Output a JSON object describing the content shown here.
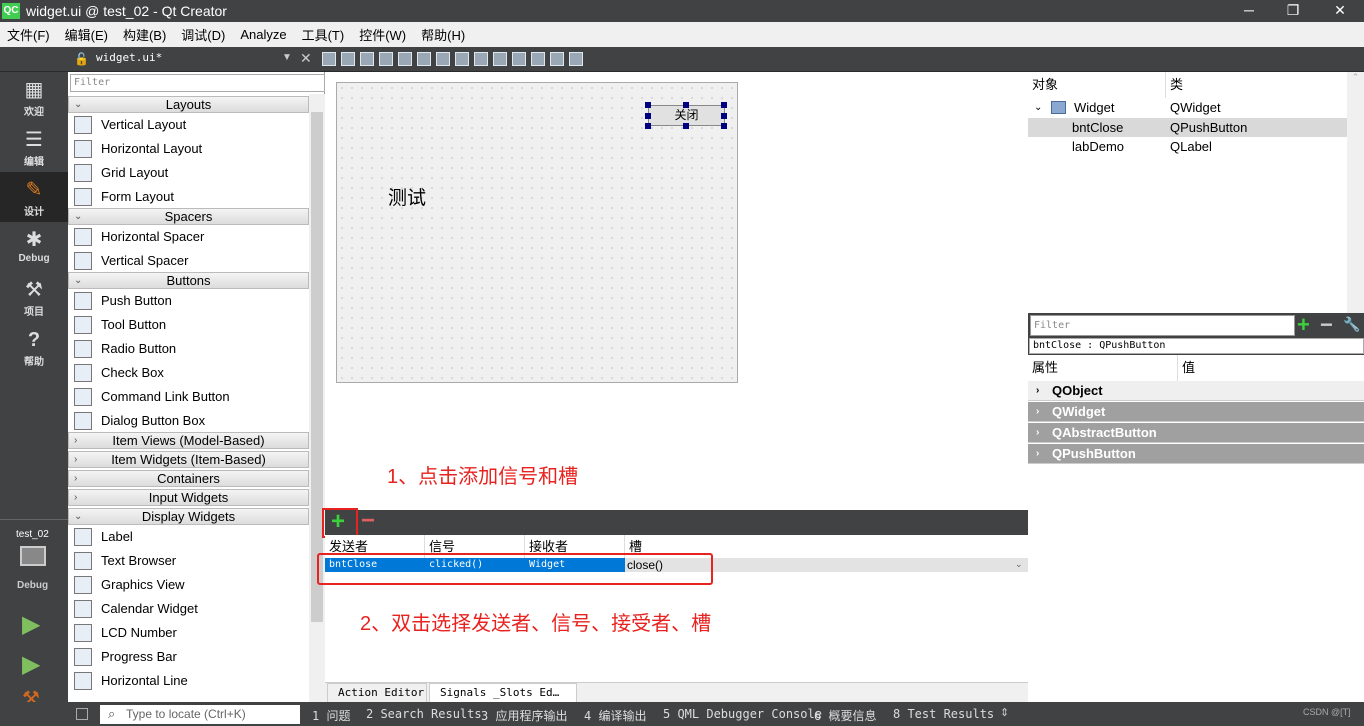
{
  "window": {
    "title": "widget.ui @ test_02 - Qt Creator",
    "logo": "QC"
  },
  "menu": [
    "文件(F)",
    "编辑(E)",
    "构建(B)",
    "调试(D)",
    "Analyze",
    "工具(T)",
    "控件(W)",
    "帮助(H)"
  ],
  "toolbar": {
    "file": "widget.ui*"
  },
  "modes": [
    {
      "label": "欢迎",
      "icon": "grid-icon"
    },
    {
      "label": "编辑",
      "icon": "document-icon"
    },
    {
      "label": "设计",
      "icon": "pencil-icon"
    },
    {
      "label": "Debug",
      "icon": "bug-icon"
    },
    {
      "label": "项目",
      "icon": "wrench-icon"
    },
    {
      "label": "帮助",
      "icon": "help-icon"
    }
  ],
  "kit": {
    "project": "test_02",
    "mode": "Debug"
  },
  "widgetbox": {
    "filter_placeholder": "Filter",
    "groups": [
      {
        "name": "Layouts",
        "expanded": true,
        "items": [
          "Vertical Layout",
          "Horizontal Layout",
          "Grid Layout",
          "Form Layout"
        ]
      },
      {
        "name": "Spacers",
        "expanded": true,
        "items": [
          "Horizontal Spacer",
          "Vertical Spacer"
        ]
      },
      {
        "name": "Buttons",
        "expanded": true,
        "items": [
          "Push Button",
          "Tool Button",
          "Radio Button",
          "Check Box",
          "Command Link Button",
          "Dialog Button Box"
        ]
      },
      {
        "name": "Item Views (Model-Based)",
        "expanded": false,
        "items": []
      },
      {
        "name": "Item Widgets (Item-Based)",
        "expanded": false,
        "items": []
      },
      {
        "name": "Containers",
        "expanded": false,
        "items": []
      },
      {
        "name": "Input Widgets",
        "expanded": false,
        "items": []
      },
      {
        "name": "Display Widgets",
        "expanded": true,
        "items": [
          "Label",
          "Text Browser",
          "Graphics View",
          "Calendar Widget",
          "LCD Number",
          "Progress Bar",
          "Horizontal Line"
        ]
      }
    ]
  },
  "form": {
    "button": "关闭",
    "label": "测试"
  },
  "annotations": {
    "step1": "1、点击添加信号和槽",
    "step2": "2、双击选择发送者、信号、接受者、槽"
  },
  "signals": {
    "headers": [
      "发送者",
      "信号",
      "接收者",
      "槽"
    ],
    "row": [
      "bntClose",
      "clicked()",
      "Widget",
      "close()"
    ]
  },
  "tabs": [
    "Action Editor",
    "Signals _Slots Ed…"
  ],
  "objects": {
    "headers": [
      "对象",
      "类"
    ],
    "rows": [
      {
        "name": "Widget",
        "cls": "QWidget"
      },
      {
        "name": "bntClose",
        "cls": "QPushButton"
      },
      {
        "name": "labDemo",
        "cls": "QLabel"
      }
    ]
  },
  "properties": {
    "filter_placeholder": "Filter",
    "selected": "bntClose : QPushButton",
    "headers": [
      "属性",
      "值"
    ],
    "groups": [
      "QObject",
      "QWidget",
      "QAbstractButton",
      "QPushButton"
    ]
  },
  "statusbar": {
    "locate_placeholder": "Type to locate (Ctrl+K)",
    "panes": [
      "1 问题",
      "2 Search Results",
      "3 应用程序输出",
      "4 编译输出",
      "5 QML Debugger Console",
      "6 概要信息",
      "8 Test Results"
    ],
    "watermark": "CSDN @[T]"
  }
}
